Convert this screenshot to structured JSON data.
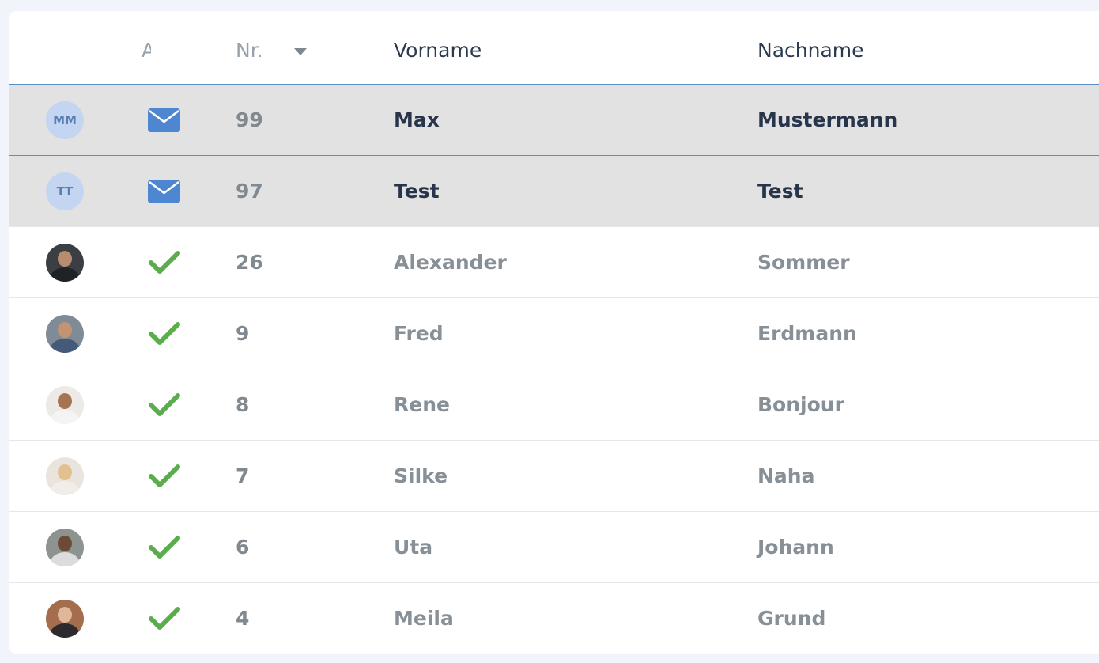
{
  "table": {
    "columns": {
      "avatar": "",
      "status": "A",
      "number": "Nr.",
      "first_name": "Vorname",
      "last_name": "Nachname"
    },
    "sort": {
      "column": "Nr.",
      "direction": "descending"
    },
    "rows": [
      {
        "initials": "MM",
        "status": "mail-icon",
        "nr": "99",
        "first": "Max",
        "last": "Mustermann",
        "selected": true
      },
      {
        "initials": "TT",
        "status": "mail-icon",
        "nr": "97",
        "first": "Test",
        "last": "Test",
        "selected": true
      },
      {
        "initials": "",
        "status": "checkmark-icon",
        "nr": "26",
        "first": "Alexander",
        "last": "Sommer",
        "selected": false
      },
      {
        "initials": "",
        "status": "checkmark-icon",
        "nr": "9",
        "first": "Fred",
        "last": "Erdmann",
        "selected": false
      },
      {
        "initials": "",
        "status": "checkmark-icon",
        "nr": "8",
        "first": "Rene",
        "last": "Bonjour",
        "selected": false
      },
      {
        "initials": "",
        "status": "checkmark-icon",
        "nr": "7",
        "first": "Silke",
        "last": "Naha",
        "selected": false
      },
      {
        "initials": "",
        "status": "checkmark-icon",
        "nr": "6",
        "first": "Uta",
        "last": "Johann",
        "selected": false
      },
      {
        "initials": "",
        "status": "checkmark-icon",
        "nr": "4",
        "first": "Meila",
        "last": "Grund",
        "selected": false
      }
    ]
  },
  "colors": {
    "selected_row": "#e2e2e2",
    "mail_icon": "#4f86d2",
    "check_icon": "#5bac4c",
    "initials_bg": "#c3d5f1",
    "initials_fg": "#5b7fb5",
    "header_divider": "#5a8fc4"
  }
}
